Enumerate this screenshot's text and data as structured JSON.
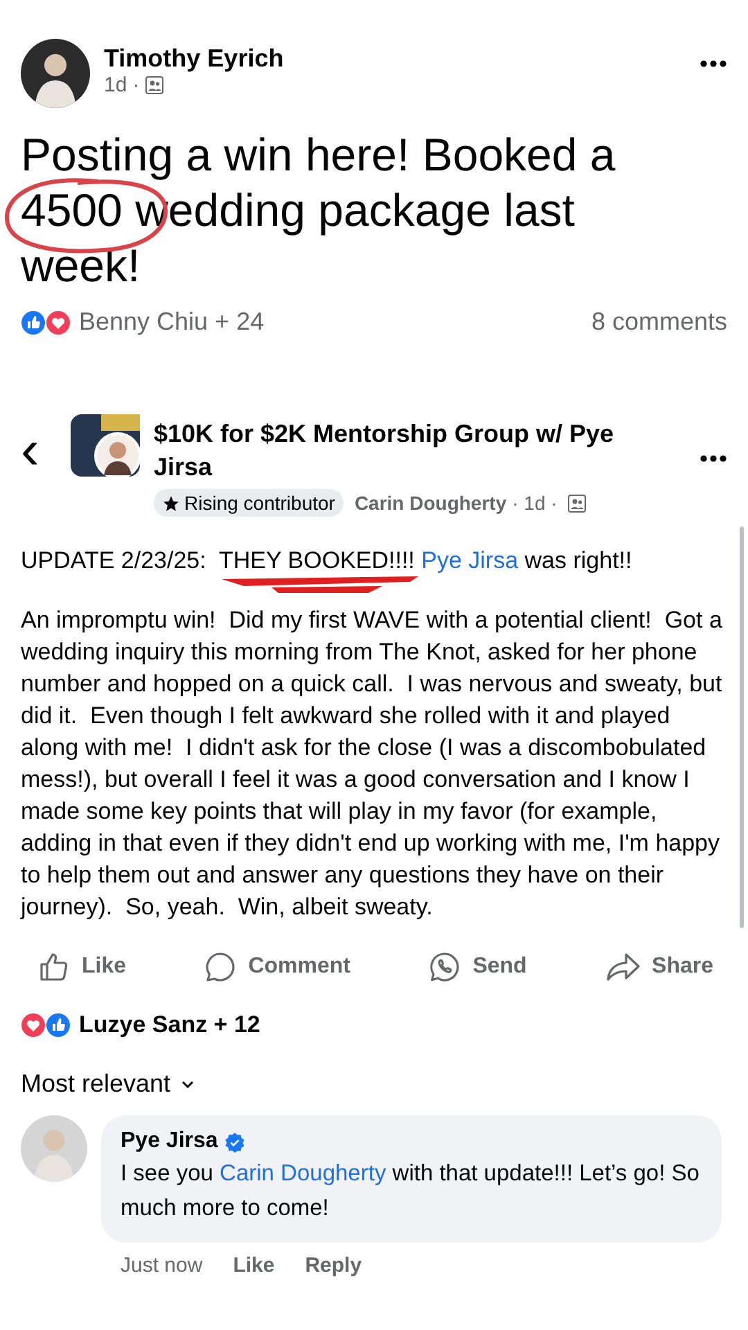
{
  "post": {
    "author": "Timothy Eyrich",
    "time": "1d",
    "separator": "·",
    "text": "Posting a win here! Booked a 4500 wedding package last week!",
    "circled": true,
    "reactions": {
      "names": "Benny Chiu + 24",
      "comments": "8 comments"
    }
  },
  "shared_post": {
    "back": "‹",
    "group": "$10K for $2K Mentorship Group w/ Pye Jirsa",
    "badge": "Rising contributor",
    "author": "Carin Dougherty",
    "time": "· 1d ·",
    "paragraphs": [
      {
        "parts": [
          {
            "kind": "text",
            "text": "UPDATE 2/23/25:  "
          },
          {
            "kind": "underlined",
            "text": "THEY BOOKED!!!!"
          },
          {
            "kind": "link",
            "text": "Pye Jirsa"
          },
          {
            "kind": "text",
            "text": " was right!!"
          }
        ]
      },
      {
        "parts": [
          {
            "kind": "text",
            "text": "An impromptu win!  Did my first WAVE with a potential client!  Got a wedding inquiry this morning from The Knot, asked for her phone number and hopped on a quick call.  I was nervous and sweaty, but did it.  Even though I felt awkward she rolled with it and played along with me!  I didn't ask for the close (I was a discombobulated mess!), but overall I feel it was a good conversation and I know I made some key points that will play in my favor (for example, adding in that even if they didn't end up working with me, I'm happy to help them out and answer any questions they have on their journey).  So, yeah.  Win, albeit sweaty."
          }
        ]
      }
    ]
  },
  "actions": [
    {
      "kind": "like",
      "label": "Like"
    },
    {
      "kind": "comment",
      "label": "Comment"
    },
    {
      "kind": "send",
      "label": "Send"
    },
    {
      "kind": "share",
      "label": "Share"
    }
  ],
  "reactions": {
    "names": "Luzye Sanz + 12"
  },
  "sort": {
    "label": "Most relevant"
  },
  "comments": [
    {
      "author": "Pye Jirsa",
      "verified": true,
      "parts": [
        {
          "kind": "text",
          "text": "I see you "
        },
        {
          "kind": "link",
          "text": "Carin Dougherty"
        },
        {
          "kind": "text",
          "text": " with that update!!! Let’s go! So much more to come!"
        }
      ],
      "time": "Just now",
      "actions": [
        "Like",
        "Reply"
      ]
    }
  ]
}
